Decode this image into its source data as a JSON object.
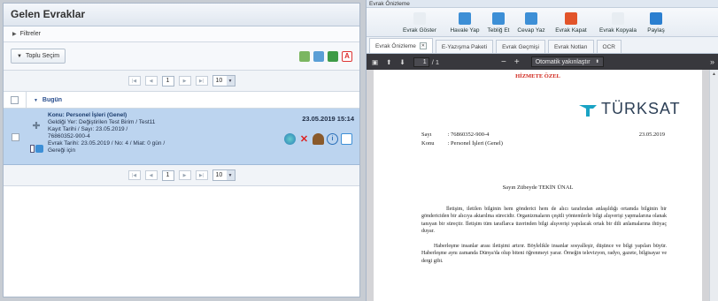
{
  "left": {
    "title": "Gelen Evraklar",
    "filters_label": "Filtreler",
    "bulk_select_label": "Toplu Seçim",
    "pager": {
      "page": "1",
      "page_size": "10"
    },
    "group_label": "Bugün",
    "item": {
      "title": "Konu: Personel İşleri (Genel)",
      "line1": "Geldiği Yer: Değiştirilen Test Birim / Test11",
      "line2": "Kayıt Tarihi / Sayı: 23.05.2019 /",
      "line3": "76860352-900-4",
      "line4": "Evrak Tarihi: 23.05.2019 / No: 4 / Miat: 0 gün /",
      "line5": "Gereği için",
      "date": "23.05.2019 15:14"
    }
  },
  "right": {
    "title": "Evrak Önizleme",
    "toolbar": [
      {
        "label": "Evrak Göster",
        "icon": "document-view-icon",
        "color": "#e8edf2"
      },
      {
        "label": "Havale Yap",
        "icon": "forward-icon",
        "color": "#3d8fd6"
      },
      {
        "label": "Tebliğ Et",
        "icon": "notify-icon",
        "color": "#3d8fd6"
      },
      {
        "label": "Cevap Yaz",
        "icon": "reply-icon",
        "color": "#3d8fd6"
      },
      {
        "label": "Evrak Kapat",
        "icon": "close-document-icon",
        "color": "#e2542a"
      },
      {
        "label": "Evrak Kopyala",
        "icon": "copy-icon",
        "color": "#e8edf2"
      },
      {
        "label": "Paylaş",
        "icon": "share-icon",
        "color": "#2b7fd0"
      }
    ],
    "tabs": [
      "Evrak Önizleme",
      "E-Yazışma Paketi",
      "Evrak Geçmişi",
      "Evrak Notları",
      "OCR"
    ],
    "pdf": {
      "page_current": "1",
      "page_total": "/ 1",
      "zoom": "Otomatik yakınlaştır",
      "header_mark": "HİZMETE ÖZEL",
      "logo_text": "TÜRKSAT",
      "sayi_label": "Sayı",
      "sayi_value": ": 76860352-900-4",
      "konu_label": "Konu",
      "konu_value": ": Personel İşleri (Genel)",
      "date": "23.05.2019",
      "salutation": "Sayın Zübeyde TEKİN ÜNAL",
      "para1": "İletişim, iletilen bilginin hem gönderici hem de alıcı tarafından anlaşıldığı ortamda bilginin bir göndericiden bir alıcıya aktarılma sürecidir. Organizmaların çeşitli yöntemlerle bilgi alışverişi yapmalarına olanak tanıyan bir süreçtir. İletişim tüm taraflarca üzerinden bilgi alışverişi yapılacak ortak bir dili anlamalarına ihtiyaç duyar.",
      "para2": "Haberleşme insanlar arası iletişimi artırır. Böylelikle insanlar sosyalleşir, düşünce ve bilgi yapıları büyür. Haberleşme aynı zamanda Dünya'da olup biteni öğrenmeyi yarar. Örneğin televizyon, radyo, gazete, bilgisayar ve dergi gibi."
    }
  }
}
